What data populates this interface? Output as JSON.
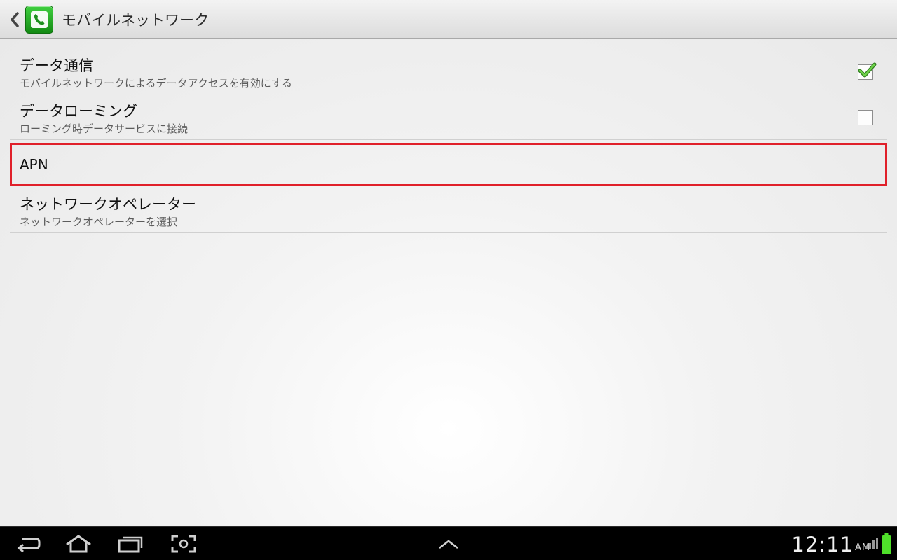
{
  "action_bar": {
    "title": "モバイルネットワーク",
    "back_icon": "chevron-left-icon",
    "app_icon": "phone-icon",
    "app_icon_color": "#22a822"
  },
  "settings": {
    "items": [
      {
        "title": "データ通信",
        "summary": "モバイルネットワークによるデータアクセスを有効にする",
        "checked": true
      },
      {
        "title": "データローミング",
        "summary": "ローミング時データサービスに接続",
        "checked": false
      },
      {
        "title": "APN",
        "highlight_color": "#e0202a"
      },
      {
        "title": "ネットワークオペレーター",
        "summary": "ネットワークオペレーターを選択"
      }
    ]
  },
  "system_bar": {
    "time": "12:11",
    "ampm": "AM",
    "nav_icons": [
      "back-icon",
      "home-icon",
      "recent-apps-icon",
      "screenshot-icon",
      "expand-up-icon"
    ],
    "battery_color": "#4fe02a"
  }
}
